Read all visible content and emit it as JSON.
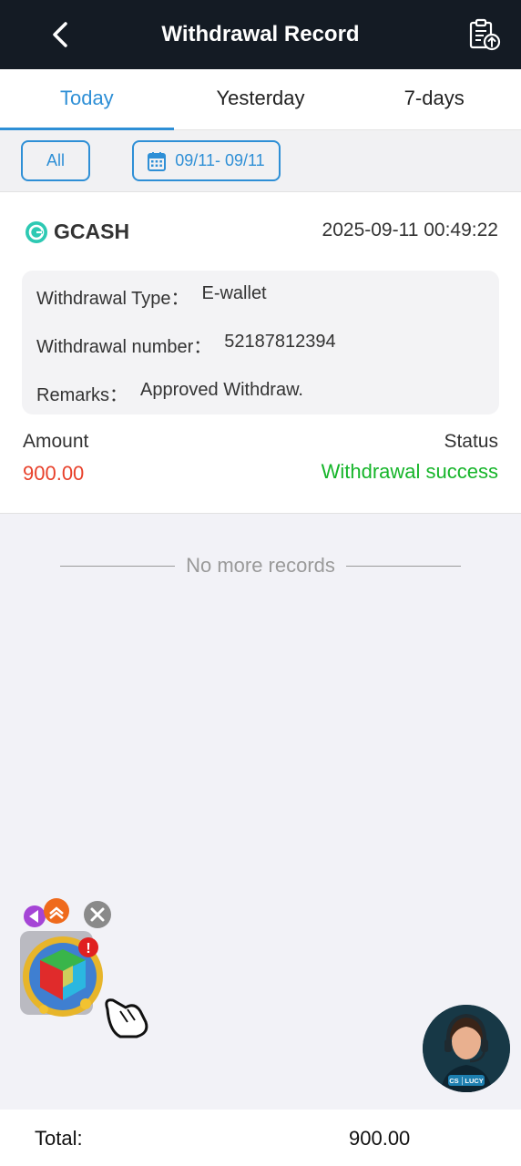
{
  "header": {
    "title": "Withdrawal Record"
  },
  "tabs": [
    {
      "label": "Today",
      "active": true
    },
    {
      "label": "Yesterday",
      "active": false
    },
    {
      "label": "7-days",
      "active": false
    }
  ],
  "filters": {
    "all_label": "All",
    "date_range": "09/11- 09/11"
  },
  "record": {
    "method": "GCASH",
    "datetime": "2025-09-11 00:49:22",
    "type_label": "Withdrawal Type：",
    "type_value": "E-wallet",
    "number_label": "Withdrawal number：",
    "number_value": "52187812394",
    "remarks_label": "Remarks：",
    "remarks_value": "Approved Withdraw.",
    "amount_label": "Amount",
    "amount_value": "900.00",
    "status_label": "Status",
    "status_value": "Withdrawal success"
  },
  "list_end": "No more records",
  "support": {
    "badge": "CS │LUCY"
  },
  "footer": {
    "total_label": "Total:",
    "total_value": "900.00"
  },
  "colors": {
    "header_bg": "#141b24",
    "accent": "#2e8fd6",
    "amount": "#e8412b",
    "success": "#16b52a",
    "gcash": "#2dc9b3"
  }
}
